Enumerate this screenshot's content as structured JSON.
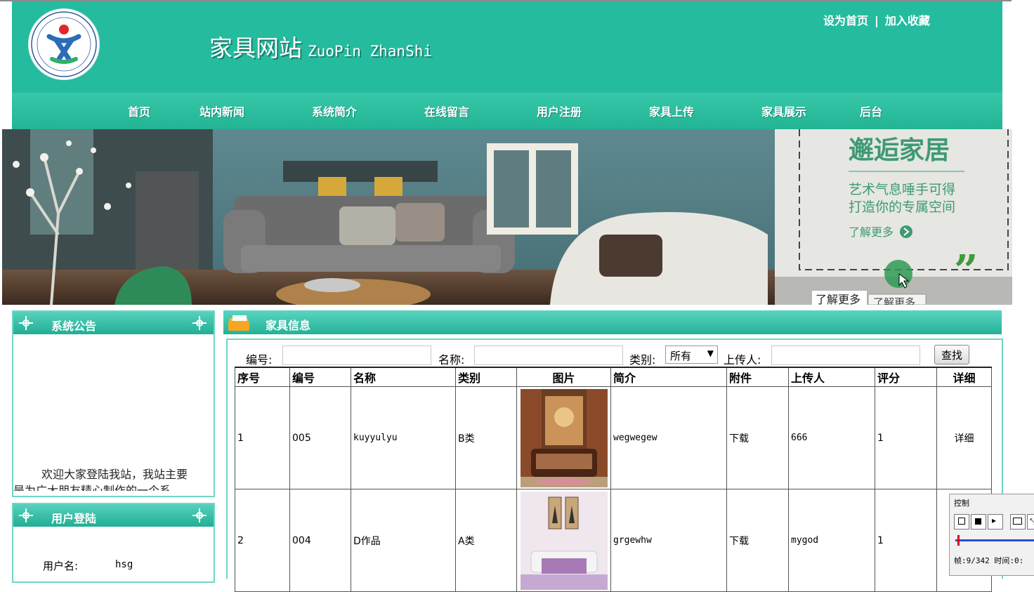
{
  "header": {
    "site_title": "家具网站",
    "site_subtitle": "ZuoPin ZhanShi",
    "top_links": [
      "设为首页",
      "加入收藏"
    ],
    "top_link_separator": "|",
    "brand_color": "#25bb9e"
  },
  "nav": {
    "items": [
      "首页",
      "站内新闻",
      "系统简介",
      "在线留言",
      "用户注册",
      "家具上传",
      "家具展示",
      "后台"
    ]
  },
  "banner": {
    "headline": "邂逅家居",
    "line1": "艺术气息唾手可得",
    "line2": "打造你的专属空间",
    "more": "了解更多",
    "tab1": "了解更多",
    "tab2": "了解更多"
  },
  "sidebar": {
    "notice_title": "系统公告",
    "notice_text": "欢迎大家登陆我站，我站主要",
    "notice_text_2": "是为广大朋友精心制作的一个系",
    "login_title": "用户登陆",
    "username_label": "用户名:",
    "username_value": "hsg"
  },
  "main": {
    "title": "家具信息",
    "search": {
      "code_label": "编号:",
      "name_label": "名称:",
      "category_label": "类别:",
      "category_selected": "所有",
      "uploader_label": "上传人:",
      "button": "查找"
    },
    "columns": [
      "序号",
      "编号",
      "名称",
      "类别",
      "图片",
      "简介",
      "附件",
      "上传人",
      "评分",
      "详细"
    ],
    "rows": [
      {
        "seq": "1",
        "code": "005",
        "name": "kuyyulyu",
        "category": "B类",
        "intro": "wegwegew",
        "attachment": "下载",
        "uploader": "666",
        "score": "1",
        "detail": "详细"
      },
      {
        "seq": "2",
        "code": "004",
        "name": "D作品",
        "category": "A类",
        "intro": "grgewhw",
        "attachment": "下载",
        "uploader": "mygod",
        "score": "1",
        "detail": ""
      }
    ]
  },
  "control_popup": {
    "title": "控制",
    "status": "帧:9/342 时间:0:"
  }
}
